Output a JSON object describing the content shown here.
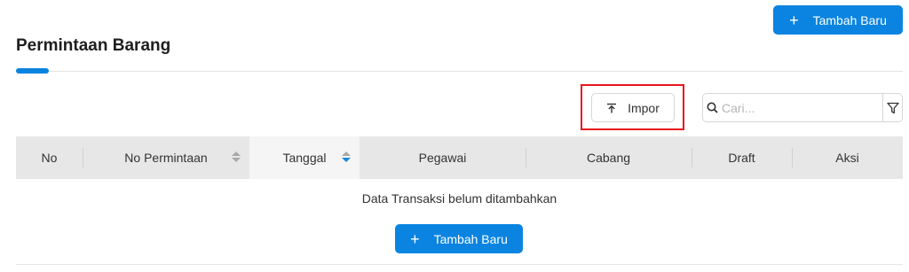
{
  "header": {
    "add_label": "Tambah Baru",
    "title": "Permintaan Barang"
  },
  "toolbar": {
    "import_label": "Impor",
    "search_placeholder": "Cari..."
  },
  "table": {
    "columns": [
      {
        "label": "No",
        "sortable": false
      },
      {
        "label": "No Permintaan",
        "sortable": true
      },
      {
        "label": "Tanggal",
        "sortable": true,
        "sorted": "desc"
      },
      {
        "label": "Pegawai",
        "sortable": false
      },
      {
        "label": "Cabang",
        "sortable": false
      },
      {
        "label": "Draft",
        "sortable": false
      },
      {
        "label": "Aksi",
        "sortable": false
      }
    ],
    "empty_message": "Data Transaksi belum ditambahkan",
    "empty_add_label": "Tambah Baru"
  },
  "colors": {
    "accent": "#0a84e0",
    "highlight": "#e8161c"
  }
}
